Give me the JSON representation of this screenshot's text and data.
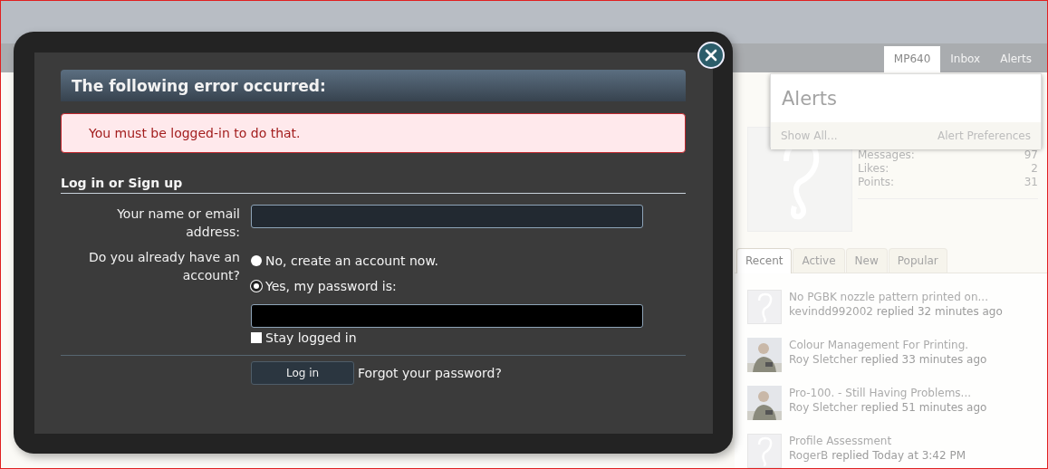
{
  "header": {
    "nav_tabs": [
      {
        "label": "MP640",
        "selected": true
      },
      {
        "label": "Inbox",
        "selected": false
      },
      {
        "label": "Alerts",
        "selected": false
      }
    ]
  },
  "alerts_menu": {
    "title": "Alerts",
    "links": [
      "Show All...",
      "Alert Preferences"
    ]
  },
  "profile": {
    "stats": [
      {
        "label": "Messages:",
        "value": "97"
      },
      {
        "label": "Likes:",
        "value": "2"
      },
      {
        "label": "Points:",
        "value": "31"
      }
    ]
  },
  "activity": {
    "tabs": [
      {
        "label": "Recent",
        "selected": true
      },
      {
        "label": "Active",
        "selected": false
      },
      {
        "label": "New",
        "selected": false
      },
      {
        "label": "Popular",
        "selected": false
      }
    ],
    "items": [
      {
        "title": "No PGBK nozzle pattern printed on...",
        "user": "kevindd992002",
        "text": "replied 32 minutes ago",
        "kind": "placeholder"
      },
      {
        "title": "Colour Management For Printing.",
        "user": "Roy Sletcher",
        "text": "replied 33 minutes ago"
      },
      {
        "title": "Pro-100. - Still Having Problems...",
        "user": "Roy Sletcher",
        "text": "replied 51 minutes ago"
      },
      {
        "title": "Profile Assessment",
        "user": "RogerB",
        "text": "replied Today at 3:42 PM",
        "kind": "placeholder"
      }
    ]
  },
  "dialog": {
    "error_title": "The following error occurred:",
    "error_message": "You must be logged-in to do that.",
    "section_title": "Log in or Sign up",
    "name_label": "Your name or email address:",
    "account_label": "Do you already have an account?",
    "options": [
      {
        "label": "No, create an account now.",
        "selected": false
      },
      {
        "label": "Yes, my password is:",
        "selected": true
      }
    ],
    "stay_logged_in": {
      "label": "Stay logged in",
      "checked": false
    },
    "login_button": "Log in",
    "forgot_link": "Forgot your password?"
  }
}
